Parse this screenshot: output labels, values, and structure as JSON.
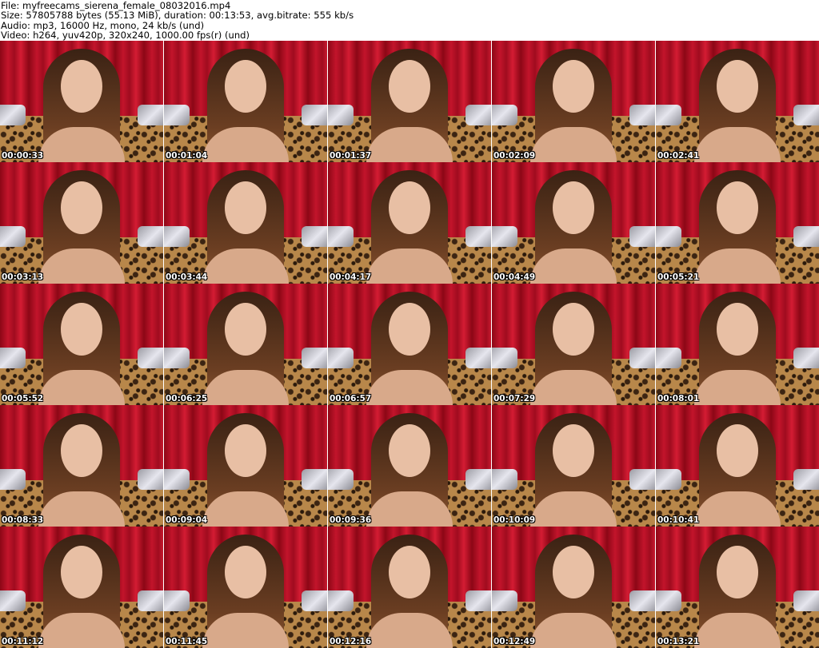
{
  "header": {
    "file_line": "File: myfreecams_sierena_female_08032016.mp4",
    "size_line": "Size: 57805788 bytes (55.13 MiB), duration: 00:13:53, avg.bitrate: 555 kb/s",
    "audio_line": "Audio: mp3, 16000 Hz, mono, 24 kb/s (und)",
    "video_line": "Video: h264, yuv420p, 320x240, 1000.00 fps(r) (und)"
  },
  "thumbnails": [
    {
      "timestamp": "00:00:33"
    },
    {
      "timestamp": "00:01:04"
    },
    {
      "timestamp": "00:01:37"
    },
    {
      "timestamp": "00:02:09"
    },
    {
      "timestamp": "00:02:41"
    },
    {
      "timestamp": "00:03:13"
    },
    {
      "timestamp": "00:03:44"
    },
    {
      "timestamp": "00:04:17"
    },
    {
      "timestamp": "00:04:49"
    },
    {
      "timestamp": "00:05:21"
    },
    {
      "timestamp": "00:05:52"
    },
    {
      "timestamp": "00:06:25"
    },
    {
      "timestamp": "00:06:57"
    },
    {
      "timestamp": "00:07:29"
    },
    {
      "timestamp": "00:08:01"
    },
    {
      "timestamp": "00:08:33"
    },
    {
      "timestamp": "00:09:04"
    },
    {
      "timestamp": "00:09:36"
    },
    {
      "timestamp": "00:10:09"
    },
    {
      "timestamp": "00:10:41"
    },
    {
      "timestamp": "00:11:12"
    },
    {
      "timestamp": "00:11:45"
    },
    {
      "timestamp": "00:12:16"
    },
    {
      "timestamp": "00:12:49"
    },
    {
      "timestamp": "00:13:21"
    }
  ],
  "colors": {
    "backdrop": "#b01022",
    "couch": "#b8874a",
    "stamp_text": "#ffffff"
  }
}
